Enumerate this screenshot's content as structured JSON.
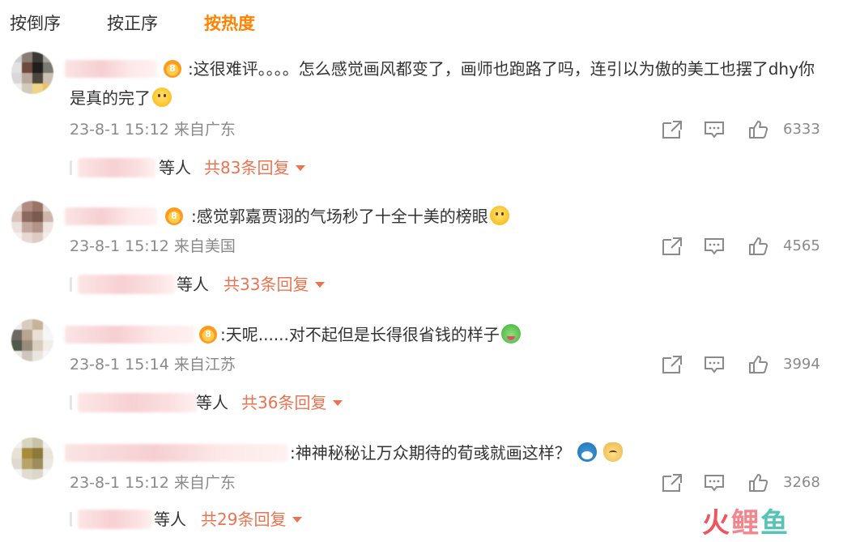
{
  "tabs": [
    {
      "label": "按倒序",
      "active": false
    },
    {
      "label": "按正序",
      "active": false
    },
    {
      "label": "按热度",
      "active": true
    }
  ],
  "colors": {
    "accent": "#ff8200",
    "reply_link": "#eb7350",
    "meta": "#8a8a8a"
  },
  "icons": {
    "share": "share-icon",
    "comment": "comment-icon",
    "like": "like-icon",
    "expand": "caret-down-icon"
  },
  "comments": [
    {
      "text": ":这很难评。。。。怎么感觉画风都变了，画师也跑路了吗，连引以为傲的美工也摆了dhy你是真的完了",
      "emoji": "face-emoji",
      "time": "23-8-1 15:12 来自广东",
      "likes": "6333",
      "reply_suffix": "等人",
      "reply_total": "共83条回复"
    },
    {
      "text": ":感觉郭嘉贾诩的气场秒了十全十美的榜眼",
      "emoji": "face-emoji",
      "time": "23-8-1 15:12 来自美国",
      "likes": "4565",
      "reply_suffix": "等人",
      "reply_total": "共33条回复"
    },
    {
      "text": ":天呢......对不起但是长得很省钱的样子",
      "emoji": "frog-emoji",
      "time": "23-8-1 15:14 来自江苏",
      "likes": "3994",
      "reply_suffix": "等人",
      "reply_total": "共36条回复"
    },
    {
      "text": ":神神秘秘让万众期待的荀彧就画这样？",
      "emoji": "cat-emoji",
      "time": "23-8-1 15:12 来自广东",
      "likes": "3268",
      "reply_suffix": "等人",
      "reply_total": "共29条回复"
    }
  ],
  "watermark": {
    "text1": "火",
    "text2": "鲤",
    "text3": "鱼"
  }
}
